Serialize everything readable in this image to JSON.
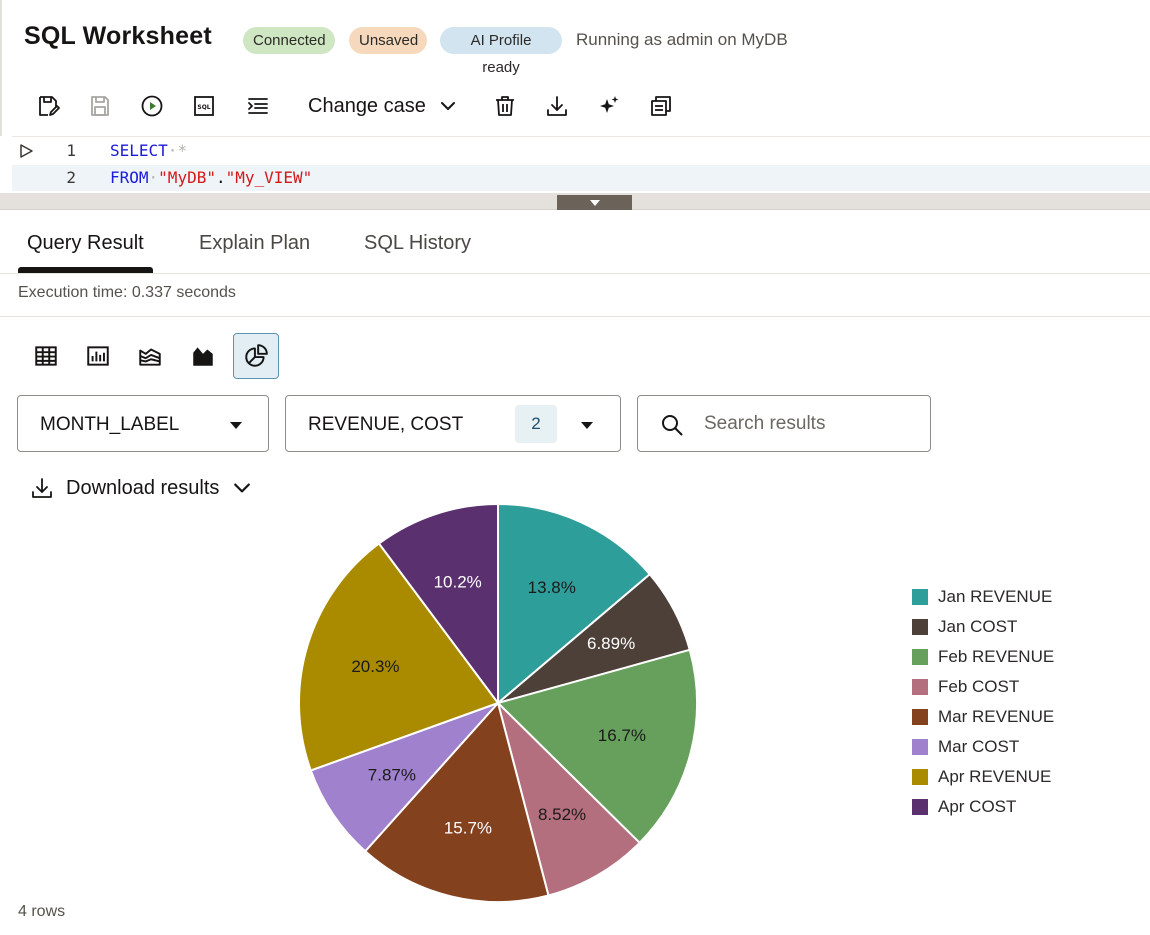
{
  "header": {
    "title": "SQL Worksheet",
    "badges": {
      "connected": "Connected",
      "unsaved": "Unsaved",
      "ai": "AI Profile ready"
    },
    "running": "Running as admin on MyDB"
  },
  "toolbar": {
    "icons": [
      "save-as-icon",
      "save-icon",
      "run-icon",
      "sql-icon",
      "format-icon",
      "trash-icon",
      "download-icon",
      "sparkle-icon",
      "copy-icon"
    ],
    "change_case": "Change case"
  },
  "editor": {
    "lines": [
      {
        "number": "1",
        "keyword": "SELECT",
        "rest": "*"
      },
      {
        "number": "2",
        "keyword": "FROM",
        "schema": "\"MyDB\"",
        "dot": ".",
        "object": "\"My_VIEW\""
      }
    ]
  },
  "tabs": [
    "Query Result",
    "Explain Plan",
    "SQL History"
  ],
  "active_tab": "Query Result",
  "execution_time": "Execution time: 0.337 seconds",
  "view_buttons": [
    "table-view-icon",
    "bar-chart-icon",
    "area-chart-icon",
    "funnel-chart-icon",
    "pie-chart-icon"
  ],
  "active_view": "pie-chart-icon",
  "selects": {
    "x_column": "MONTH_LABEL",
    "y_columns": "REVENUE, COST",
    "y_count": "2"
  },
  "search": {
    "placeholder": "Search results"
  },
  "download": "Download results",
  "footer": {
    "rows": "4 rows"
  },
  "chart_data": {
    "type": "pie",
    "legend_position": "right",
    "slices": [
      {
        "label": "Jan REVENUE",
        "value": 13.8,
        "display": "13.8%",
        "color": "#2e9e9b",
        "text_color": "#1a1a1a"
      },
      {
        "label": "Jan COST",
        "value": 6.89,
        "display": "6.89%",
        "color": "#4d4039",
        "text_color": "#ffffff"
      },
      {
        "label": "Feb REVENUE",
        "value": 16.7,
        "display": "16.7%",
        "color": "#67a05d",
        "text_color": "#1a1a1a"
      },
      {
        "label": "Feb COST",
        "value": 8.52,
        "display": "8.52%",
        "color": "#b46f7e",
        "text_color": "#1a1a1a"
      },
      {
        "label": "Mar REVENUE",
        "value": 15.7,
        "display": "15.7%",
        "color": "#83411e",
        "text_color": "#ffffff"
      },
      {
        "label": "Mar COST",
        "value": 7.87,
        "display": "7.87%",
        "color": "#9f81cd",
        "text_color": "#1a1a1a"
      },
      {
        "label": "Apr REVENUE",
        "value": 20.3,
        "display": "20.3%",
        "color": "#aa8b00",
        "text_color": "#1a1a1a"
      },
      {
        "label": "Apr COST",
        "value": 10.2,
        "display": "10.2%",
        "color": "#5a306e",
        "text_color": "#ffffff"
      }
    ]
  }
}
